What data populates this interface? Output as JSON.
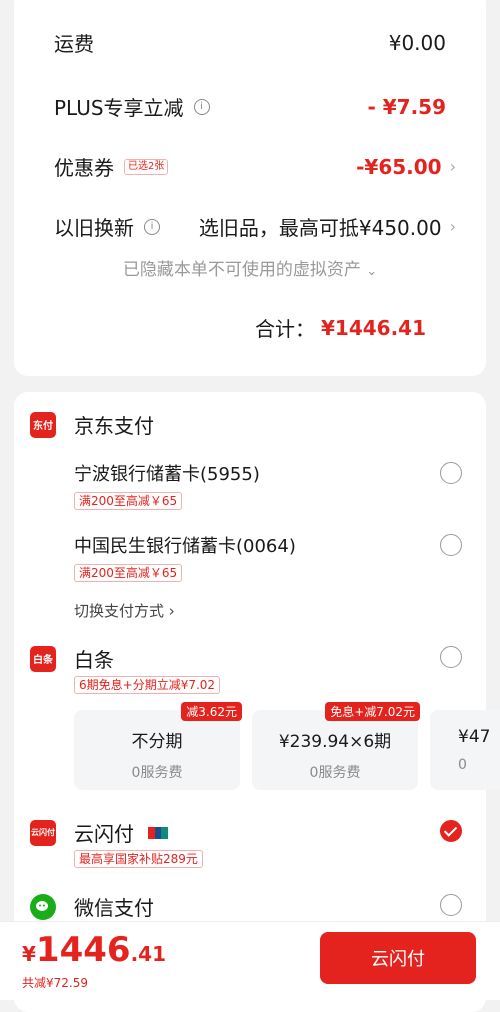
{
  "summary": {
    "shipping_label": "运费",
    "shipping_value": "¥0.00",
    "plus_label": "PLUS专享立减",
    "plus_value": "- ¥7.59",
    "coupon_label": "优惠券",
    "coupon_badge": "已选2张",
    "coupon_value": "-¥65.00",
    "tradein_label": "以旧换新",
    "tradein_value": "选旧品，最高可抵¥450.00",
    "hidden_note": "已隐藏本单不可使用的虚拟资产",
    "total_label": "合计：",
    "total_value": "¥1446.41"
  },
  "payment": {
    "jd_pay": {
      "title": "京东支付",
      "icon_text": "东付",
      "cards": [
        {
          "name": "宁波银行储蓄卡(5955)",
          "promo": "满200至高减￥65"
        },
        {
          "name": "中国民生银行储蓄卡(0064)",
          "promo": "满200至高减￥65"
        }
      ],
      "switch_label": "切换支付方式"
    },
    "baitiao": {
      "title": "白条",
      "icon_text": "白条",
      "promo": "6期免息+分期立减¥7.02",
      "plans": [
        {
          "tag": "减3.62元",
          "title": "不分期",
          "fee": "0服务费"
        },
        {
          "tag": "免息+减7.02元",
          "title": "¥239.94×6期",
          "fee": "0服务费"
        },
        {
          "title": "¥47",
          "fee": "0"
        }
      ]
    },
    "unionpay": {
      "title": "云闪付",
      "icon_text": "云闪付",
      "promo": "最高享国家补贴289元"
    },
    "wechat": {
      "title": "微信支付"
    }
  },
  "footer": {
    "currency": "¥",
    "amount_int": "1446",
    "amount_dec": ".41",
    "saving": "共减¥72.59",
    "pay_button": "云闪付"
  },
  "colors": {
    "accent": "#e4231e",
    "wechat": "#1aad19"
  }
}
